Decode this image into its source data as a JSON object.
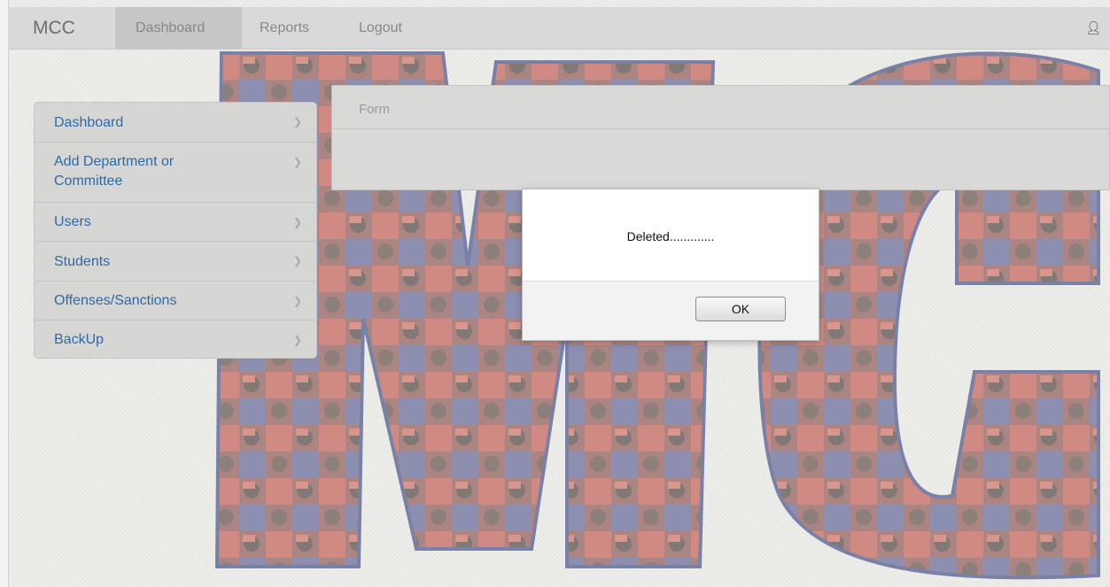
{
  "navbar": {
    "brand": "MCC",
    "items": [
      {
        "label": "Dashboard",
        "active": true
      },
      {
        "label": "Reports",
        "active": false
      },
      {
        "label": "Logout",
        "active": false
      }
    ],
    "user_icon": "user-icon"
  },
  "sidebar": {
    "items": [
      {
        "label": "Dashboard"
      },
      {
        "label": "Add Department or Committee"
      },
      {
        "label": "Users"
      },
      {
        "label": "Students"
      },
      {
        "label": "Offenses/Sanctions"
      },
      {
        "label": "BackUp"
      }
    ],
    "chevron_icon": "chevron-right-icon"
  },
  "form_panel": {
    "title": "Form"
  },
  "dialog": {
    "message": "Deleted.............",
    "ok_label": "OK"
  },
  "colors": {
    "link": "#2f6aa6",
    "backdrop_red": "#c63a2c",
    "backdrop_blue": "#34448a"
  }
}
